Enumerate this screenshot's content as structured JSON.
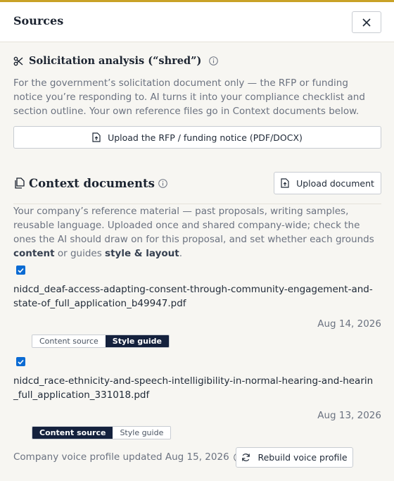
{
  "header": {
    "title": "Sources",
    "close_icon": "close-icon"
  },
  "solicitation": {
    "title": "Solicitation analysis (“shred”)",
    "description": "For the government’s solicitation document only — the RFP or funding notice you’re responding to. AI turns it into your compliance checklist and section outline. Your own reference files go in Context documents below.",
    "upload_label": "Upload the RFP / funding notice (PDF/DOCX)"
  },
  "context": {
    "title": "Context documents",
    "upload_label": "Upload document",
    "desc_part1": "Your company’s reference material — past proposals, writing samples, reusable language. Uploaded once and shared company-wide; check the ones the AI should draw on for this proposal, and set whether each grounds ",
    "desc_bold1": "content",
    "desc_part2": " or guides ",
    "desc_bold2": "style & layout",
    "desc_part3": ".",
    "documents": [
      {
        "checked": true,
        "filename": "nidcd_deaf-access-adapting-consent-through-community-engagement-and-state-of_full_application_b49947.pdf",
        "date": "Aug 14, 2026",
        "content_label": "Content source",
        "style_label": "Style guide",
        "selected": "style"
      },
      {
        "checked": true,
        "filename": "nidcd_race-ethnicity-and-speech-intelligibility-in-normal-hearing-and-hearin_full_application_331018.pdf",
        "date": "Aug 13, 2026",
        "content_label": "Content source",
        "style_label": "Style guide",
        "selected": "content"
      }
    ]
  },
  "voice": {
    "status": "Company voice profile updated Aug 15, 2026",
    "rebuild_label": "Rebuild voice profile"
  },
  "colors": {
    "accent_bar": "#c9a227",
    "selected_segment": "#14213d",
    "checkbox": "#0b6bd3"
  }
}
